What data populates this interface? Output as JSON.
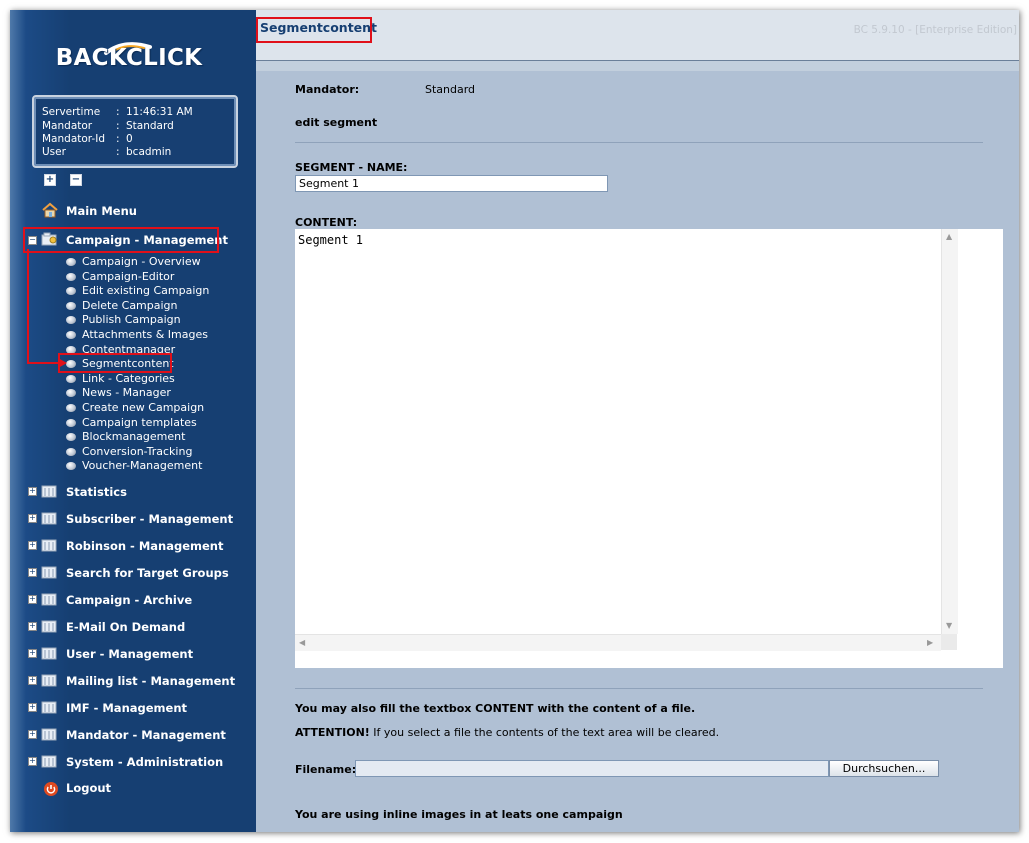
{
  "app": {
    "brand": "BACKCLICK",
    "version": "BC 5.9.10 - [Enterprise Edition]",
    "page_title": "Segmentcontent"
  },
  "info": {
    "rows": [
      {
        "key": "Servertime",
        "value": "11:46:31 AM"
      },
      {
        "key": "Mandator",
        "value": "Standard"
      },
      {
        "key": "Mandator-Id",
        "value": "0"
      },
      {
        "key": "User",
        "value": "bcadmin"
      }
    ],
    "separator": ":"
  },
  "tree_buttons": {
    "expand": "+",
    "collapse": "−"
  },
  "sidebar": {
    "main_menu": "Main Menu",
    "campaign_management": "Campaign - Management",
    "campaign_sub": [
      "Campaign - Overview",
      "Campaign-Editor",
      "Edit existing Campaign",
      "Delete Campaign",
      "Publish Campaign",
      "Attachments & Images",
      "Contentmanager",
      "Segmentcontent",
      "Link - Categories",
      "News - Manager",
      "Create new Campaign",
      "Campaign templates",
      "Blockmanagement",
      "Conversion-Tracking",
      "Voucher-Management"
    ],
    "sections": [
      "Statistics",
      "Subscriber - Management",
      "Robinson - Management",
      "Search for Target Groups",
      "Campaign - Archive",
      "E-Mail On Demand",
      "User - Management",
      "Mailing list - Management",
      "IMF - Management",
      "Mandator - Management",
      "System - Administration"
    ],
    "logout": "Logout"
  },
  "form": {
    "mandator_label": "Mandator:",
    "mandator_value": "Standard",
    "heading": "edit segment",
    "segment_name_label": "SEGMENT - NAME:",
    "segment_name_value": "Segment 1",
    "content_label": "CONTENT:",
    "content_value": "Segment 1",
    "file_hint": "You may also fill the textbox CONTENT with the content of a file.",
    "attention_label": "ATTENTION!",
    "attention_text": " If you select a file the contents of the text area will be cleared.",
    "filename_label": "Filename:",
    "browse_button": "Durchsuchen...",
    "inline_images_note": "You are using inline images in at leats one campaign"
  },
  "colors": {
    "sidebar": "#163f72",
    "content_bg": "#b0c0d4",
    "highlight": "#e0101a",
    "title": "#163f72"
  }
}
